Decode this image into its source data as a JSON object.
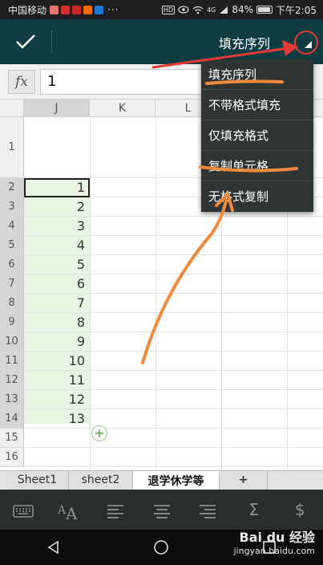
{
  "statusbar": {
    "carrier": "中国移动",
    "dots": "···",
    "hd": "HD",
    "network": "4G",
    "battery": "84%",
    "time": "下午2:05"
  },
  "toolbar": {
    "title": "填充序列"
  },
  "formula": {
    "fx": "fx",
    "value": "1"
  },
  "columns": [
    "J",
    "K",
    "L"
  ],
  "rows": [
    "1",
    "2",
    "3",
    "4",
    "5",
    "6",
    "7",
    "8",
    "9",
    "10",
    "11",
    "12",
    "13",
    "14",
    "15",
    "16"
  ],
  "cells_j": [
    "1",
    "2",
    "3",
    "4",
    "5",
    "6",
    "7",
    "8",
    "9",
    "10",
    "11",
    "12",
    "13"
  ],
  "menu": {
    "items": [
      "填充序列",
      "不带格式填充",
      "仅填充格式",
      "复制单元格",
      "无格式复制"
    ]
  },
  "sheets": {
    "tabs": [
      "Sheet1",
      "sheet2",
      "退学休学等"
    ],
    "add": "+"
  },
  "bottombar": {
    "items": [
      "keyboard-icon",
      "font-size-icon",
      "align-left-icon",
      "align-center-icon",
      "align-right-icon",
      "sum-icon",
      "currency-icon"
    ],
    "sum": "Σ",
    "currency": "$"
  },
  "watermark": {
    "line1": "Bai du 经验",
    "line2": "jingyan.baidu.com"
  },
  "colors": {
    "toolbar": "#0f3d43",
    "menu": "#2f3435",
    "fill": "#e8f5e2",
    "annotation_orange": "#f08a3c",
    "annotation_red": "#e53935"
  }
}
